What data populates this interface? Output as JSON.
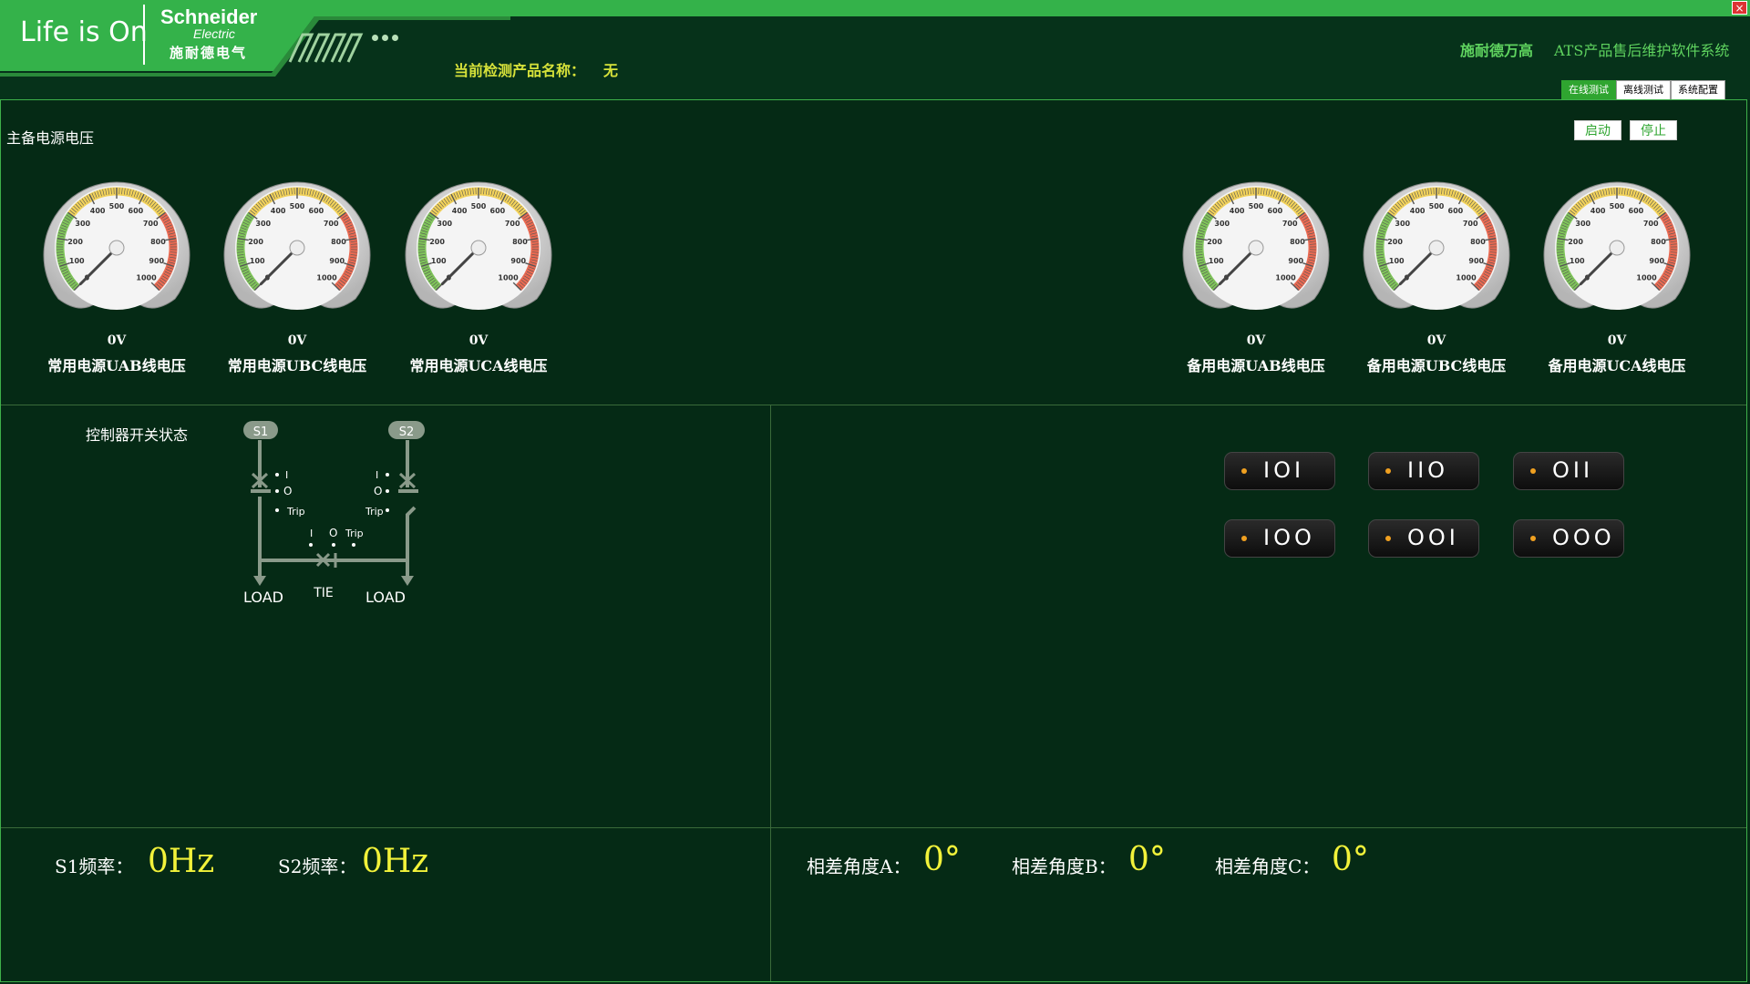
{
  "header": {
    "logo_tagline": "Life is On",
    "brand_name": "Schneider",
    "brand_sub": "Electric",
    "brand_cn": "施耐德电气",
    "product_label": "当前检测产品名称：",
    "product_value": "无",
    "company": "施耐德万高",
    "system_name": "ATS产品售后维护软件系统",
    "close_symbol": "×"
  },
  "tabs": [
    {
      "label": "在线测试",
      "active": true
    },
    {
      "label": "离线测试",
      "active": false
    },
    {
      "label": "系统配置",
      "active": false
    }
  ],
  "voltage_section": {
    "title": "主备电源电压",
    "start_label": "启动",
    "stop_label": "停止",
    "gauge_ticks": [
      "0",
      "100",
      "200",
      "300",
      "400",
      "500",
      "600",
      "700",
      "800",
      "900",
      "1000"
    ],
    "gauges": [
      {
        "value": "0V",
        "label": "常用电源UAB线电压",
        "reading": 0
      },
      {
        "value": "0V",
        "label": "常用电源UBC线电压",
        "reading": 0
      },
      {
        "value": "0V",
        "label": "常用电源UCA线电压",
        "reading": 0
      },
      {
        "value": "0V",
        "label": "备用电源UAB线电压",
        "reading": 0
      },
      {
        "value": "0V",
        "label": "备用电源UBC线电压",
        "reading": 0
      },
      {
        "value": "0V",
        "label": "备用电源UCA线电压",
        "reading": 0
      }
    ]
  },
  "controller": {
    "title": "控制器开关状态",
    "diagram": {
      "s1": "S1",
      "s2": "S2",
      "load_left": "LOAD",
      "load_right": "LOAD",
      "tie": "TIE",
      "mark_i": "I",
      "mark_o": "O",
      "mark_trip": "Trip"
    }
  },
  "states": [
    {
      "label": "IOI"
    },
    {
      "label": "IIO"
    },
    {
      "label": "OII"
    },
    {
      "label": "IOO"
    },
    {
      "label": "OOI"
    },
    {
      "label": "OOO"
    }
  ],
  "frequency": {
    "s1_label": "S1频率：",
    "s1_value": "0Hz",
    "s2_label": "S2频率：",
    "s2_value": "0Hz"
  },
  "phase": {
    "a_label": "相差角度A：",
    "a_value": "0°",
    "b_label": "相差角度B：",
    "b_value": "0°",
    "c_label": "相差角度C：",
    "c_value": "0°"
  },
  "colors": {
    "accent_green": "#34b24a",
    "background": "#052a15",
    "value_yellow": "#f2f23a",
    "status_orange": "#f0a020"
  }
}
